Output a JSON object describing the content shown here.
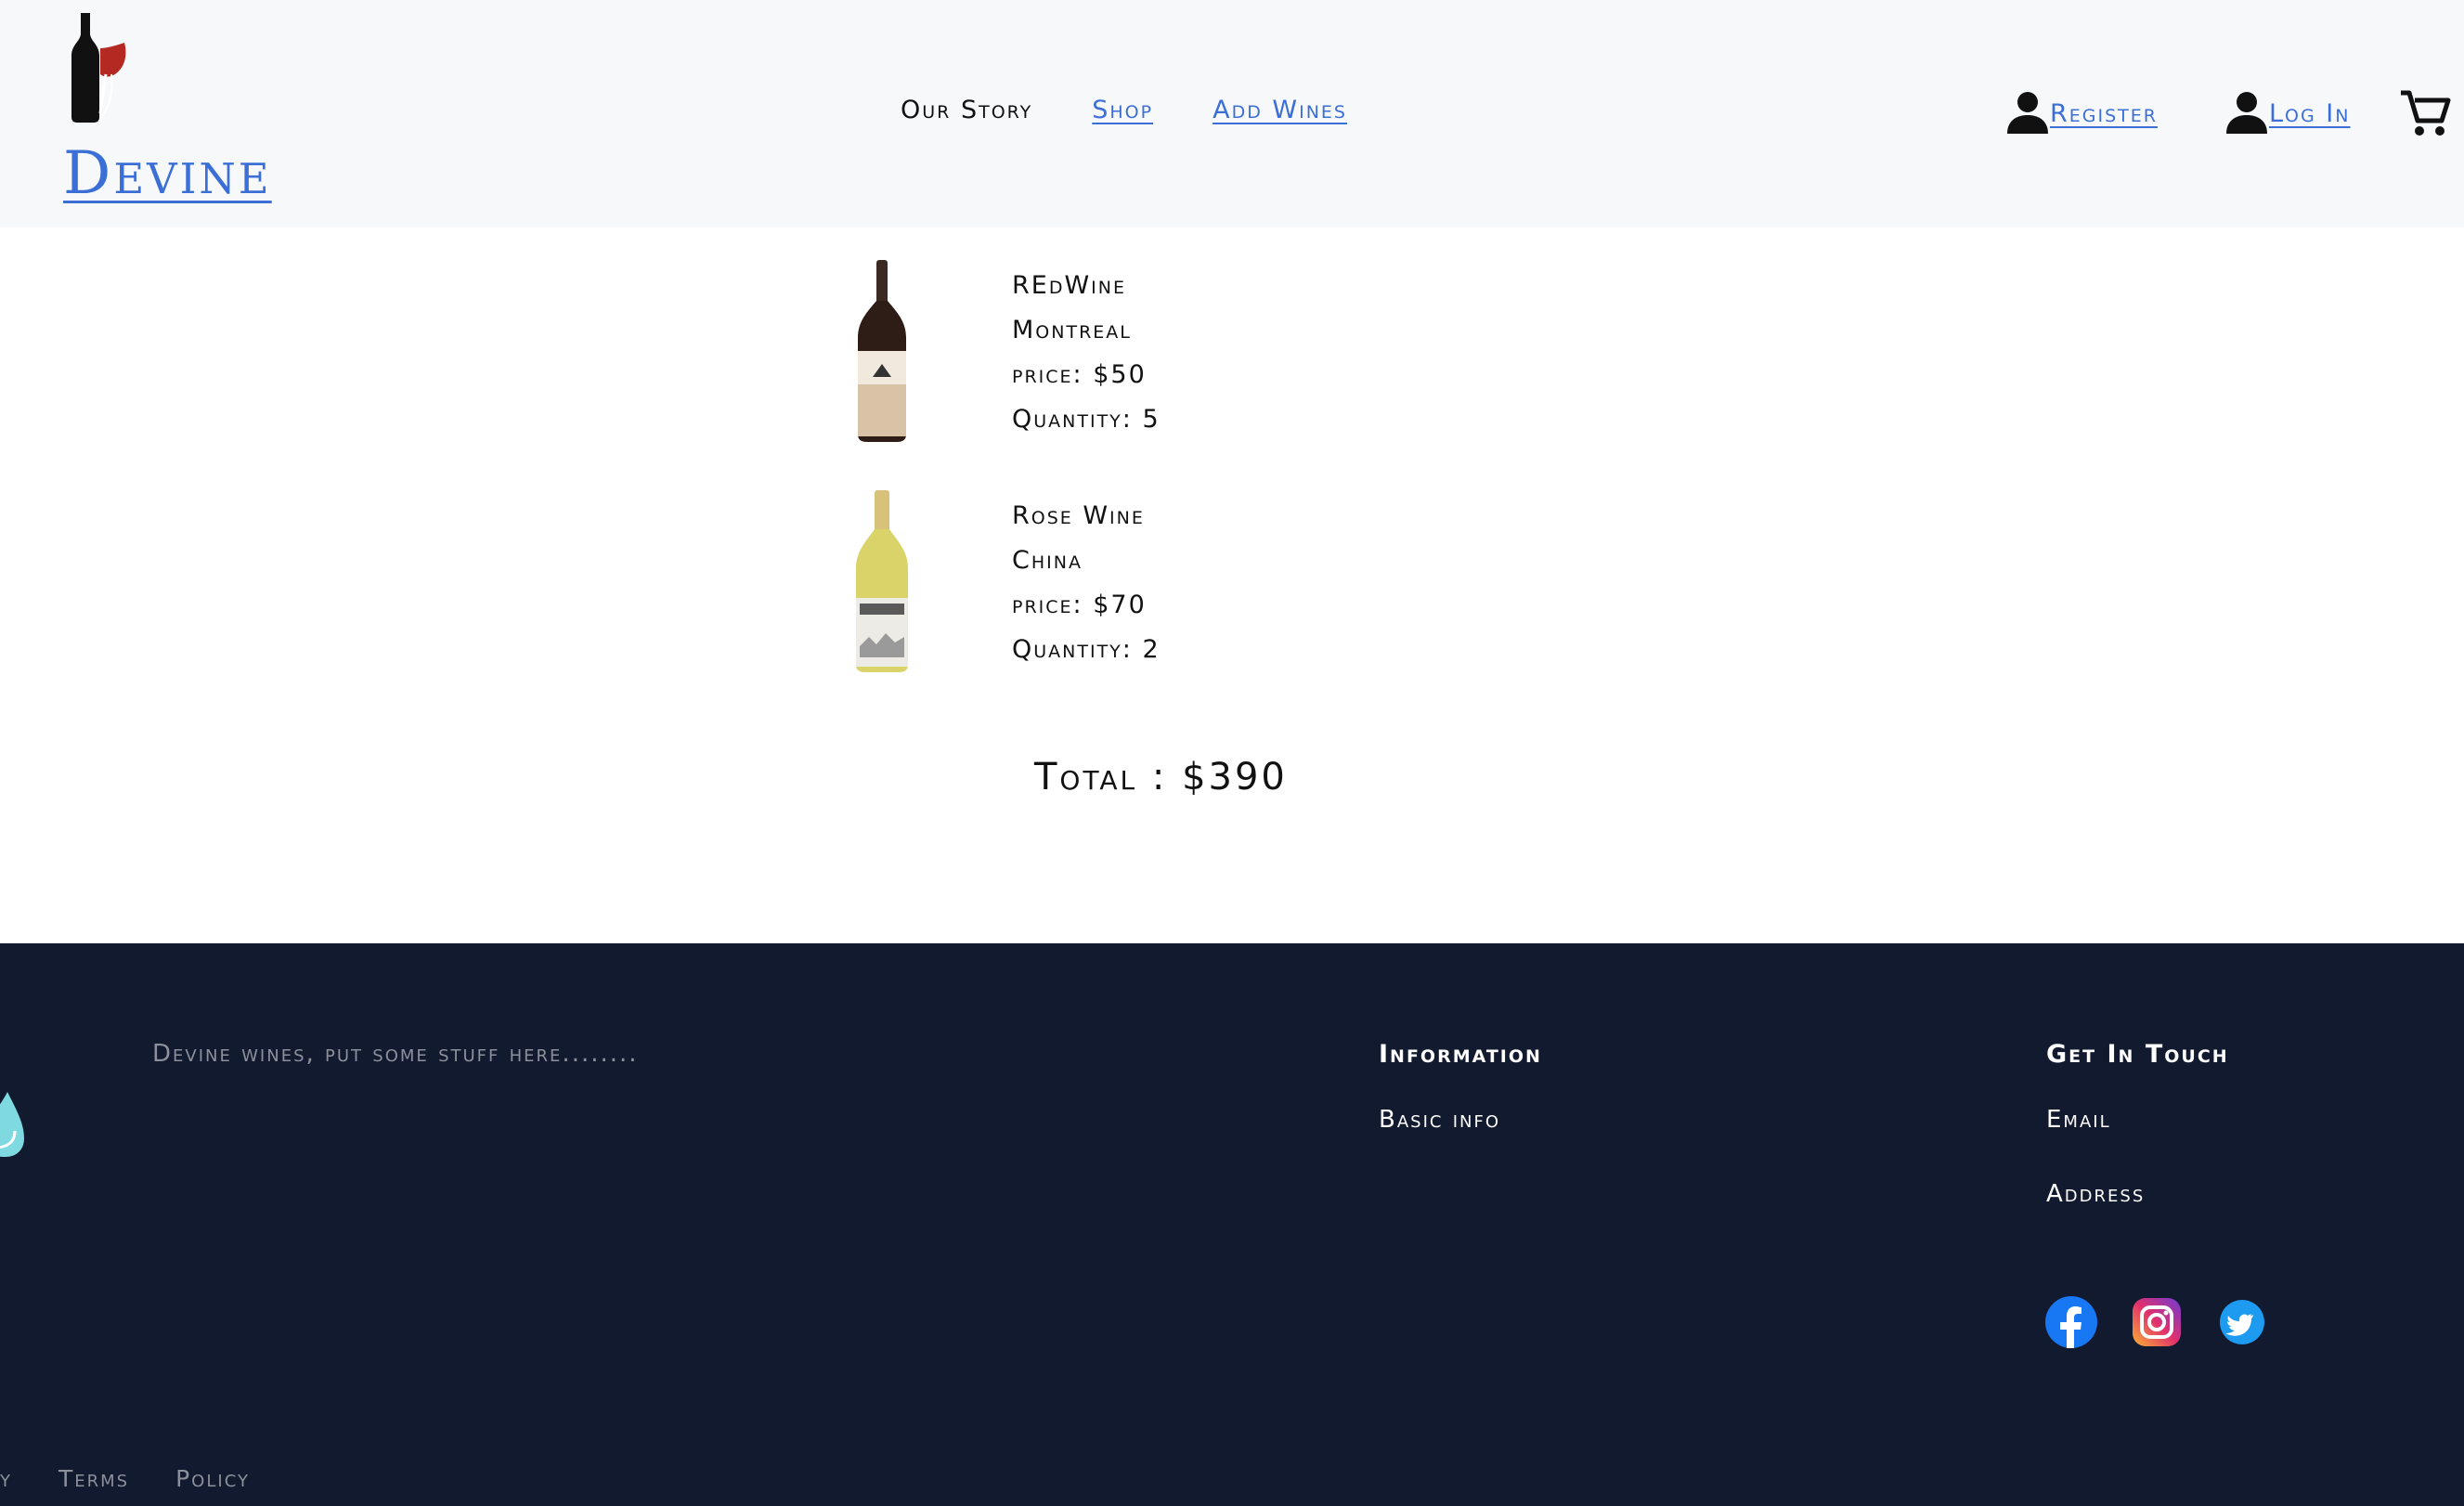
{
  "header": {
    "brand": "Devine",
    "nav": [
      {
        "label": "Our Story"
      },
      {
        "label": "Shop"
      },
      {
        "label": "Add Wines"
      }
    ],
    "register_label": "Register",
    "login_label": "Log In",
    "icons": [
      "user-icon",
      "cart-icon"
    ]
  },
  "cart": {
    "items": [
      {
        "name": "REdWine",
        "origin": "Montreal",
        "price": "price: $50",
        "quantity": "Quantity: 5"
      },
      {
        "name": "Rose Wine",
        "origin": "China",
        "price": "price: $70",
        "quantity": "Quantity: 2"
      }
    ],
    "total": "Total : $390"
  },
  "footer": {
    "tagline": "Devine wines, put some stuff here........",
    "information": {
      "heading": "Information",
      "links": [
        "Basic info"
      ]
    },
    "contact": {
      "heading": "Get In Touch",
      "links": [
        "Email",
        "Address"
      ]
    },
    "social_icons": [
      "facebook-icon",
      "instagram-icon",
      "twitter-icon"
    ],
    "bottom_links": [
      "y",
      "Terms",
      "Policy"
    ]
  },
  "colors": {
    "link": "#3b6fd6",
    "header_bg": "#f7f8fa",
    "footer_bg": "#121a2f"
  }
}
